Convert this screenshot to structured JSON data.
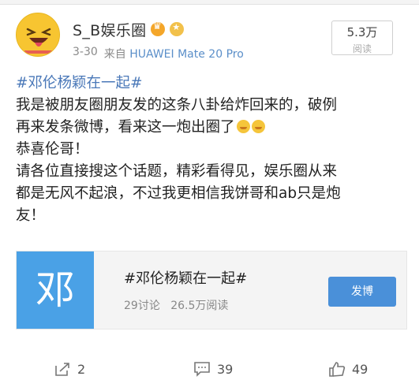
{
  "user": {
    "name": "S_B娱乐圈",
    "badges": [
      "crown-icon",
      "medal-icon"
    ],
    "avatar_colors": {
      "face": "#f7c531",
      "tongue": "#e2455b"
    }
  },
  "meta": {
    "date": "3-30",
    "source_prefix": "来自",
    "device": "HUAWEI Mate 20 Pro"
  },
  "views": {
    "count": "5.3万",
    "label": "阅读"
  },
  "post": {
    "hashtag": "#邓伦杨颖在一起#",
    "line1": "我是被朋友圈朋友发的这条八卦给炸回来的，破例",
    "line2": "再来发条微博，看来这一炮出圈了",
    "line3": "恭喜伦哥！",
    "line4": "请各位直接搜这个话题，精彩看得见，娱乐圈从来",
    "line5": "都是无风不起浪，不过我更相信我饼哥和ab只是炮",
    "line6": "友！"
  },
  "topic_card": {
    "thumb_text": "邓",
    "title": "#邓伦杨颖在一起#",
    "discussions": "29讨论",
    "reads": "26.5万阅读",
    "button": "发博",
    "colors": {
      "thumb": "#4aa1e6",
      "button": "#4a90d9"
    }
  },
  "actions": {
    "share_count": "2",
    "comment_count": "39",
    "like_count": "49"
  },
  "colors": {
    "link": "#4a78b8",
    "device": "#5b8fc9"
  }
}
